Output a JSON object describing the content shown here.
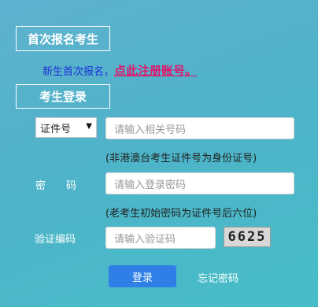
{
  "first_signup": {
    "header": "首次报名考生",
    "prefix_text": "新生首次报名，",
    "register_link": "点此注册账号。"
  },
  "login": {
    "header": "考生登录",
    "id_type_selected": "证件号",
    "id_placeholder": "请输入相关号码",
    "id_hint": "(非港澳台考生证件号为身份证号)",
    "password_label": "密码",
    "password_placeholder": "请输入登录密码",
    "password_hint": "(老考生初始密码为证件号后六位)",
    "code_label": "验证编码",
    "code_placeholder": "请输入验证码",
    "captcha_text": "6625",
    "login_button": "登录",
    "forgot_link": "忘记密码"
  },
  "colors": {
    "accent_button": "#2f7fe6",
    "register_link": "#e0156a",
    "prefix_text": "#1b2fd8"
  }
}
